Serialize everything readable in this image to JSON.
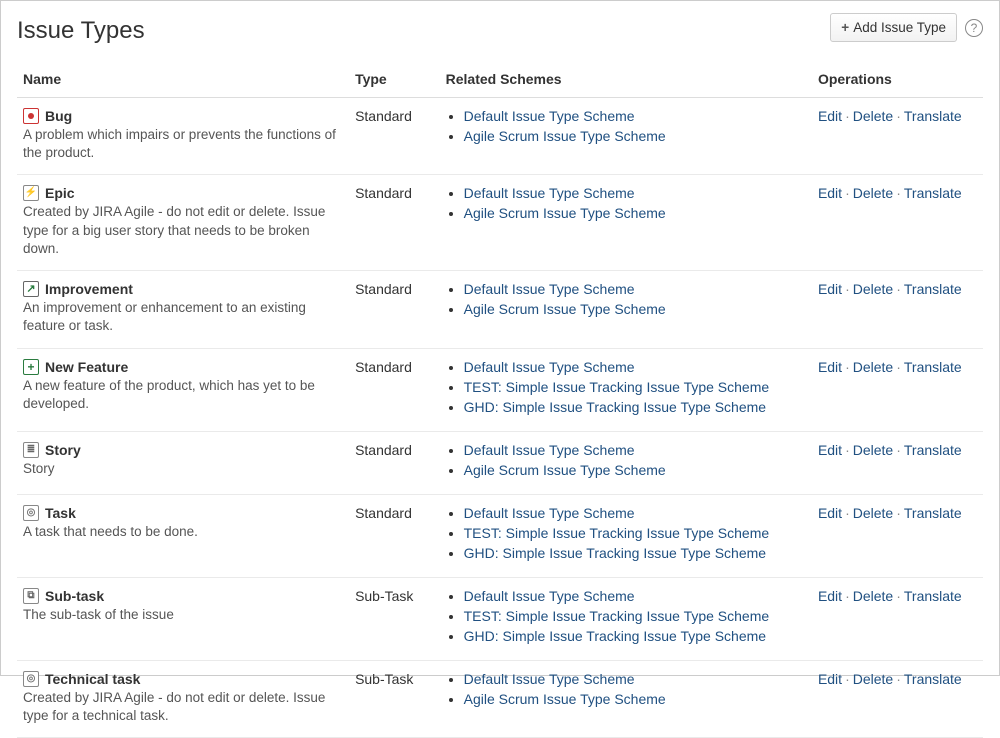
{
  "header": {
    "title": "Issue Types",
    "add_button": "Add Issue Type"
  },
  "columns": {
    "name": "Name",
    "type": "Type",
    "schemes": "Related Schemes",
    "operations": "Operations"
  },
  "operations": {
    "edit": "Edit",
    "delete": "Delete",
    "translate": "Translate"
  },
  "issue_types": [
    {
      "icon": "bug",
      "name": "Bug",
      "description": "A problem which impairs or prevents the functions of the product.",
      "type": "Standard",
      "schemes": [
        "Default Issue Type Scheme",
        "Agile Scrum Issue Type Scheme"
      ]
    },
    {
      "icon": "epic",
      "name": "Epic",
      "description": "Created by JIRA Agile - do not edit or delete. Issue type for a big user story that needs to be broken down.",
      "type": "Standard",
      "schemes": [
        "Default Issue Type Scheme",
        "Agile Scrum Issue Type Scheme"
      ]
    },
    {
      "icon": "improve",
      "name": "Improvement",
      "description": "An improvement or enhancement to an existing feature or task.",
      "type": "Standard",
      "schemes": [
        "Default Issue Type Scheme",
        "Agile Scrum Issue Type Scheme"
      ]
    },
    {
      "icon": "feature",
      "name": "New Feature",
      "description": "A new feature of the product, which has yet to be developed.",
      "type": "Standard",
      "schemes": [
        "Default Issue Type Scheme",
        "TEST: Simple Issue Tracking Issue Type Scheme",
        "GHD: Simple Issue Tracking Issue Type Scheme"
      ]
    },
    {
      "icon": "story",
      "name": "Story",
      "description": "Story",
      "type": "Standard",
      "schemes": [
        "Default Issue Type Scheme",
        "Agile Scrum Issue Type Scheme"
      ]
    },
    {
      "icon": "task",
      "name": "Task",
      "description": "A task that needs to be done.",
      "type": "Standard",
      "schemes": [
        "Default Issue Type Scheme",
        "TEST: Simple Issue Tracking Issue Type Scheme",
        "GHD: Simple Issue Tracking Issue Type Scheme"
      ]
    },
    {
      "icon": "subtask",
      "name": "Sub-task",
      "description": "The sub-task of the issue",
      "type": "Sub-Task",
      "schemes": [
        "Default Issue Type Scheme",
        "TEST: Simple Issue Tracking Issue Type Scheme",
        "GHD: Simple Issue Tracking Issue Type Scheme"
      ]
    },
    {
      "icon": "tech",
      "name": "Technical task",
      "description": "Created by JIRA Agile - do not edit or delete. Issue type for a technical task.",
      "type": "Sub-Task",
      "schemes": [
        "Default Issue Type Scheme",
        "Agile Scrum Issue Type Scheme"
      ]
    }
  ]
}
